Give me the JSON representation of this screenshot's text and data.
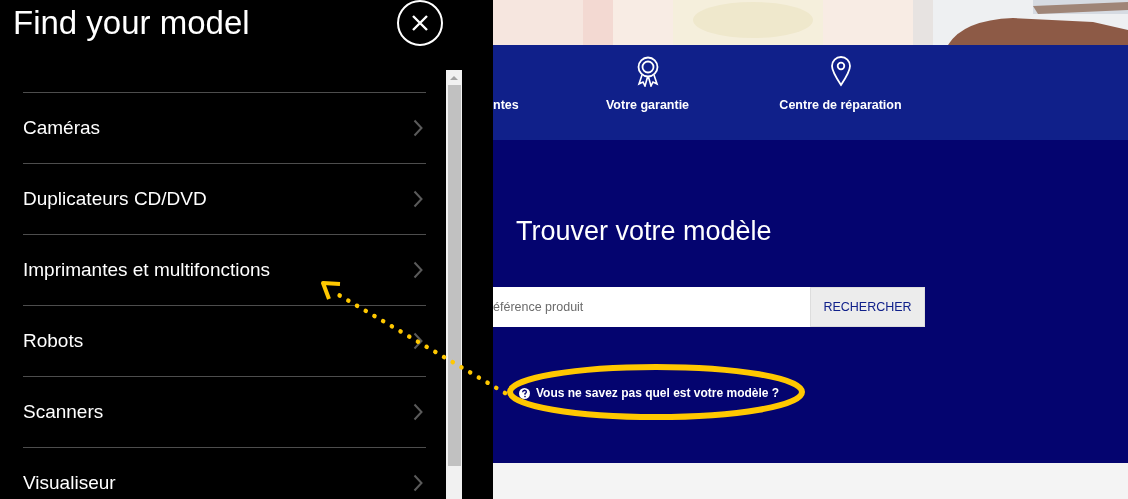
{
  "panel": {
    "title": "Find your model",
    "categories": [
      {
        "label": "Caméras"
      },
      {
        "label": "Duplicateurs CD/DVD"
      },
      {
        "label": "Imprimantes et multifonctions"
      },
      {
        "label": "Robots"
      },
      {
        "label": "Scanners"
      },
      {
        "label": "Visualiseur"
      }
    ]
  },
  "nav": [
    {
      "label": "ntes",
      "kind": "plain"
    },
    {
      "label": "Votre garantie",
      "kind": "award"
    },
    {
      "label": "Centre de réparation",
      "kind": "pin"
    }
  ],
  "finder": {
    "heading": "Trouver votre modèle",
    "search": {
      "placeholder": "éférence produit"
    },
    "button": "RECHERCHER",
    "help_link": "Vous ne savez pas quel est votre modèle ?"
  }
}
